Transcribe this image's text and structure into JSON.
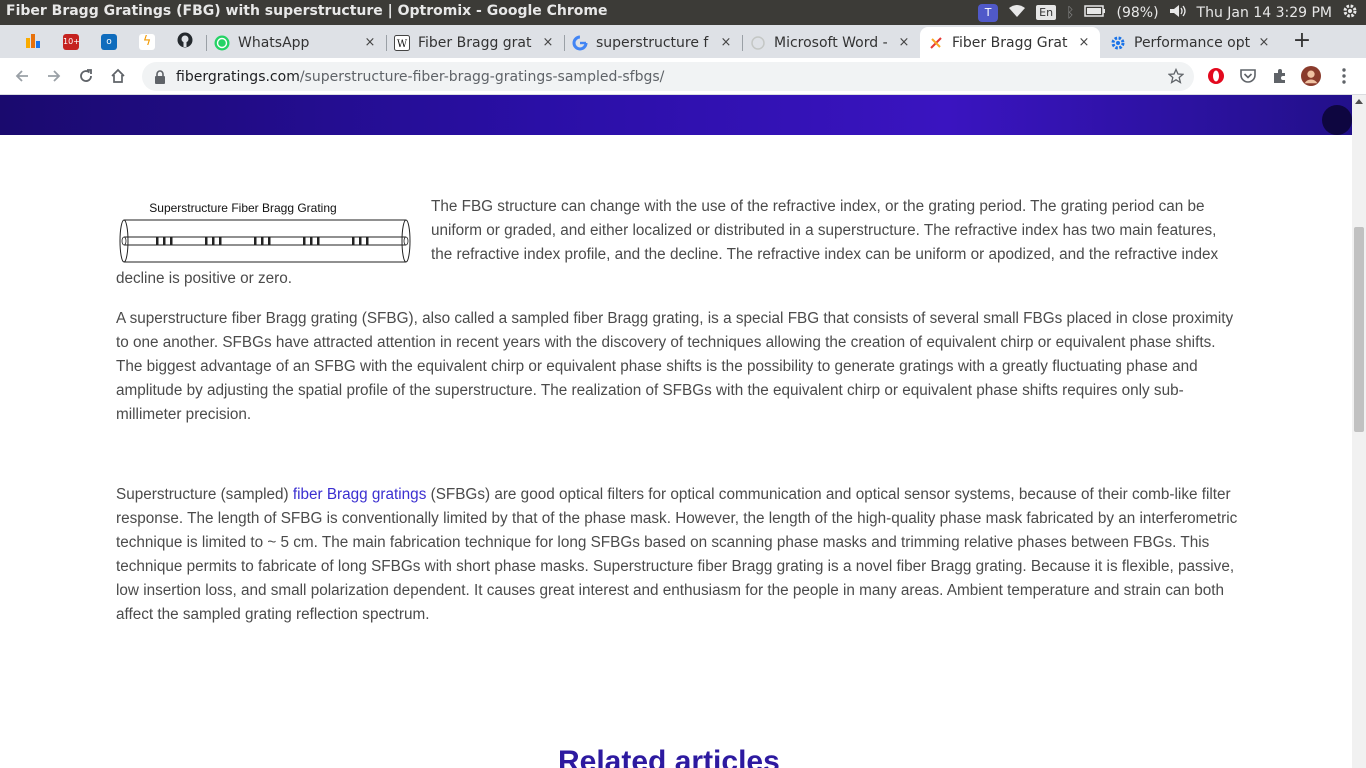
{
  "os": {
    "window_title": "Fiber Bragg Gratings (FBG) with superstructure | Optromix - Google Chrome",
    "teams_label": "T",
    "keyboard_layout": "En",
    "battery": "(98%)",
    "datetime": "Thu Jan 14  3:29 PM"
  },
  "tabs": {
    "pinned": [
      {
        "name": "analytics",
        "icon": "bar-chart-icon",
        "glyph": "▮",
        "color": "#e8710a"
      },
      {
        "name": "news",
        "icon": "news-icon",
        "glyph": "10+",
        "color": "#c5221f"
      },
      {
        "name": "outlook",
        "icon": "outlook-icon",
        "glyph": "o",
        "color": "#0f6cbd"
      },
      {
        "name": "pinned-app",
        "icon": "lightning-icon",
        "glyph": "ϟ",
        "color": "#f29900"
      },
      {
        "name": "github",
        "icon": "github-icon",
        "glyph": "●",
        "color": "#24292e"
      }
    ],
    "items": [
      {
        "label": "WhatsApp",
        "icon": "whatsapp-icon",
        "close": "×"
      },
      {
        "label": "Fiber Bragg grat",
        "icon": "wikipedia-icon",
        "close": "×"
      },
      {
        "label": "superstructure f",
        "icon": "google-icon",
        "close": "×"
      },
      {
        "label": "Microsoft Word -",
        "icon": "loading-icon",
        "close": "×"
      },
      {
        "label": "Fiber Bragg Grat",
        "icon": "optromix-icon",
        "close": "×",
        "active": true
      },
      {
        "label": "Performance opt",
        "icon": "gear-icon",
        "close": "×"
      }
    ],
    "new_tab": "+"
  },
  "toolbar": {
    "url_host": "fibergratings.com",
    "url_path": "/superstructure-fiber-bragg-gratings-sampled-sfbgs/"
  },
  "page": {
    "figure_caption": "Superstructure Fiber Bragg Grating",
    "para1": "The FBG structure can change with the use of the refractive index, or the grating period. The grating period can be uniform or graded, and either localized or distributed in a superstructure. The refractive index has two main features, the refractive index profile, and the decline. The refractive index can be uniform or apodized, and the refractive index decline is positive or zero.",
    "para2": "A superstructure fiber Bragg grating (SFBG), also called a sampled fiber Bragg grating, is a special FBG that consists of several small FBGs placed in close proximity to one another. SFBGs have attracted attention in recent years with the discovery of techniques allowing the creation of equivalent chirp or equivalent phase shifts. The biggest advantage of an SFBG with the equivalent chirp or equivalent phase shifts is the possibility to generate gratings with a greatly fluctuating phase and amplitude by adjusting the spatial profile of the superstructure. The realization of SFBGs with the equivalent chirp or equivalent phase shifts requires only sub-millimeter precision.",
    "para3_before": "Superstructure (sampled) ",
    "para3_link": "fiber Bragg gratings",
    "para3_after": " (SFBGs) are good optical filters for optical communication and optical sensor systems, because of their comb-like filter response. The length of SFBG is conventionally limited by that of the phase mask. However, the length of the high-quality phase mask fabricated by an interferometric technique is limited to ~ 5 cm.  The main fabrication technique for long SFBGs based on scanning phase masks and trimming relative phases between FBGs. This technique permits to fabricate of long SFBGs with short phase masks. Superstructure fiber Bragg grating is a novel fiber Bragg grating. Because it is flexible, passive, low insertion loss, and small polarization dependent. It causes great interest and enthusiasm for the people in many areas. Ambient temperature and strain can both affect the sampled grating reflection spectrum.",
    "related_heading": "Related articles"
  }
}
